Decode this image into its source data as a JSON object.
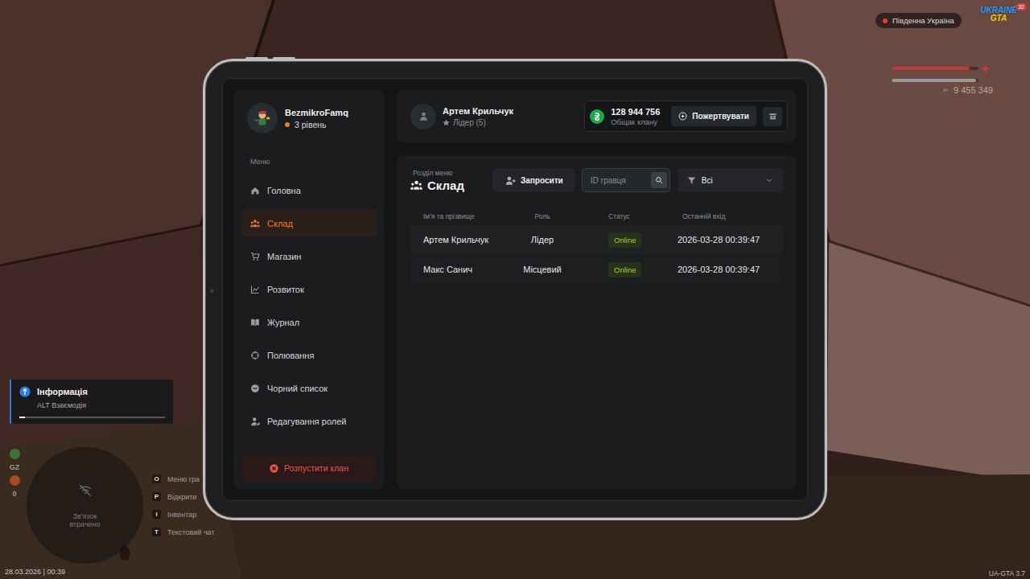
{
  "hud": {
    "region": "Південна Україна",
    "logo": {
      "top": "UKRAINE",
      "bottom": "GTA",
      "badge": "32"
    },
    "health": {
      "level": 0.9
    },
    "armor": {
      "level": 0.97
    },
    "money": "9 455 349",
    "notification": {
      "title": "Інформація",
      "text": "ALT Взаємодія",
      "level": 0.04
    },
    "minimap": {
      "text": "Зв'язок втрачено"
    },
    "status_icons": [
      {
        "kind": "dot",
        "color": "#3f8a3a"
      },
      {
        "kind": "text",
        "label": "GZ"
      },
      {
        "kind": "dot",
        "color": "#c2561f"
      },
      {
        "kind": "text",
        "label": "0"
      }
    ],
    "key_hints": [
      {
        "key": "O",
        "label": "Меню гра"
      },
      {
        "key": "P",
        "label": "Відкрити"
      },
      {
        "key": "I",
        "label": "Інвентар"
      },
      {
        "key": "T",
        "label": "Текстовий чат"
      }
    ],
    "datetime": "28.03.2026 | 00:39",
    "version": "UA-GTA 3.7"
  },
  "profile": {
    "name": "BezmikroFamq",
    "level": "3 рівень"
  },
  "sidebar": {
    "menu_label": "Меню",
    "items": [
      {
        "label": "Головна",
        "selected": false
      },
      {
        "label": "Склад",
        "selected": true
      },
      {
        "label": "Магазин",
        "selected": false
      },
      {
        "label": "Розвиток",
        "selected": false
      },
      {
        "label": "Журнал",
        "selected": false
      },
      {
        "label": "Полювання",
        "selected": false
      },
      {
        "label": "Чорний список",
        "selected": false
      },
      {
        "label": "Редагування ролей",
        "selected": false
      }
    ],
    "dissolve_button": "Розпустити клан"
  },
  "header": {
    "member": {
      "name": "Артем Крильчук",
      "role": "Лідер (5)"
    },
    "funds": {
      "amount": "128 944 756",
      "label": "Общак клану"
    },
    "donate_button": "Пожертвувати"
  },
  "content": {
    "section_label": "Розділ меню",
    "title": "Склад",
    "invite_button": "Запросити",
    "search": {
      "placeholder": "ID гравця"
    },
    "filter": {
      "value": "Всі"
    }
  },
  "table": {
    "columns": [
      "Ім'я та прізвище",
      "Роль",
      "Статус",
      "Останній вхід"
    ],
    "rows": [
      [
        "Артем Крильчук",
        "Лідер",
        "Online",
        "2026-03-28 00:39:47"
      ],
      [
        "Макс Санич",
        "Місцевий",
        "Online",
        "2026-03-28 00:39:47"
      ]
    ]
  }
}
